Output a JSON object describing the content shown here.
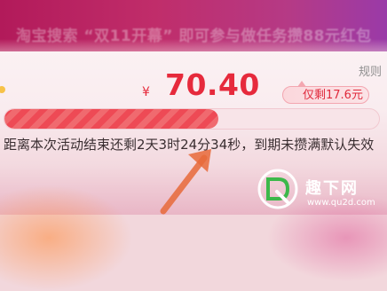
{
  "banner": {
    "text": "淘宝搜索 “双11开幕” 即可参与做任务攒88元红包"
  },
  "header": {
    "rules_label": "规则"
  },
  "price": {
    "currency_symbol": "¥",
    "amount": "70.40"
  },
  "remaining": {
    "text": "仅剩17.6元"
  },
  "progress": {
    "fraction": 0.57
  },
  "countdown": {
    "text": "距离本次活动结束还剩2天3时24分34秒，到期未攒满默认失效"
  },
  "watermark": {
    "brand": "趣下网",
    "url": "www.qu2d.com"
  },
  "colors": {
    "accent": "#e62a3c",
    "banner_bg": "#b21a5a",
    "progress_fill": "#ee4a55"
  }
}
